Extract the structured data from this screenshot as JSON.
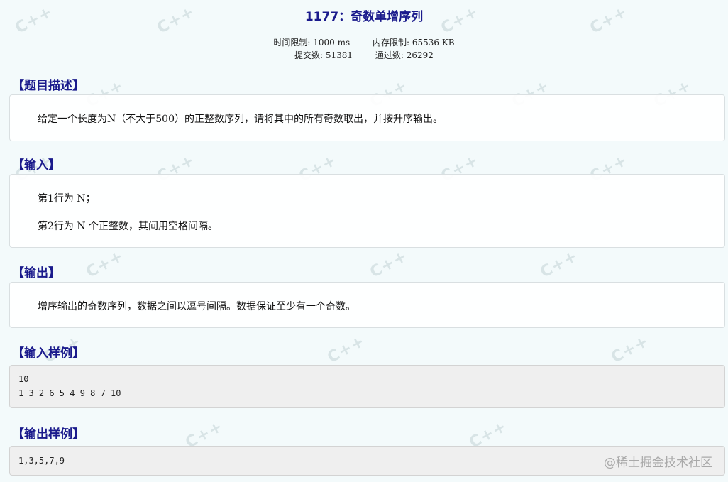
{
  "problem": {
    "title": "1177：奇数单增序列",
    "time_limit": "时间限制: 1000 ms",
    "memory_limit": "内存限制: 65536 KB",
    "submissions": "提交数: 51381",
    "accepted": "通过数: 26292"
  },
  "sections": {
    "description": {
      "title": "【题目描述】",
      "text": "给定一个长度为N（不大于500）的正整数序列，请将其中的所有奇数取出，并按升序输出。"
    },
    "input": {
      "title": "【输入】",
      "line1": "第1行为 N；",
      "line2": "第2行为 N 个正整数，其间用空格间隔。"
    },
    "output": {
      "title": "【输出】",
      "text": "增序输出的奇数序列，数据之间以逗号间隔。数据保证至少有一个奇数。"
    },
    "sample_input": {
      "title": "【输入样例】",
      "line1": "10",
      "line2": "1 3 2 6 5 4 9 8 7 10"
    },
    "sample_output": {
      "title": "【输出样例】",
      "line1": "1,3,5,7,9"
    }
  },
  "watermark": {
    "bg_text": "C++",
    "footer": "@稀土掘金技术社区"
  },
  "colors": {
    "heading": "#1a1a8c",
    "background": "#f3fafb",
    "code_background": "#efefef"
  }
}
